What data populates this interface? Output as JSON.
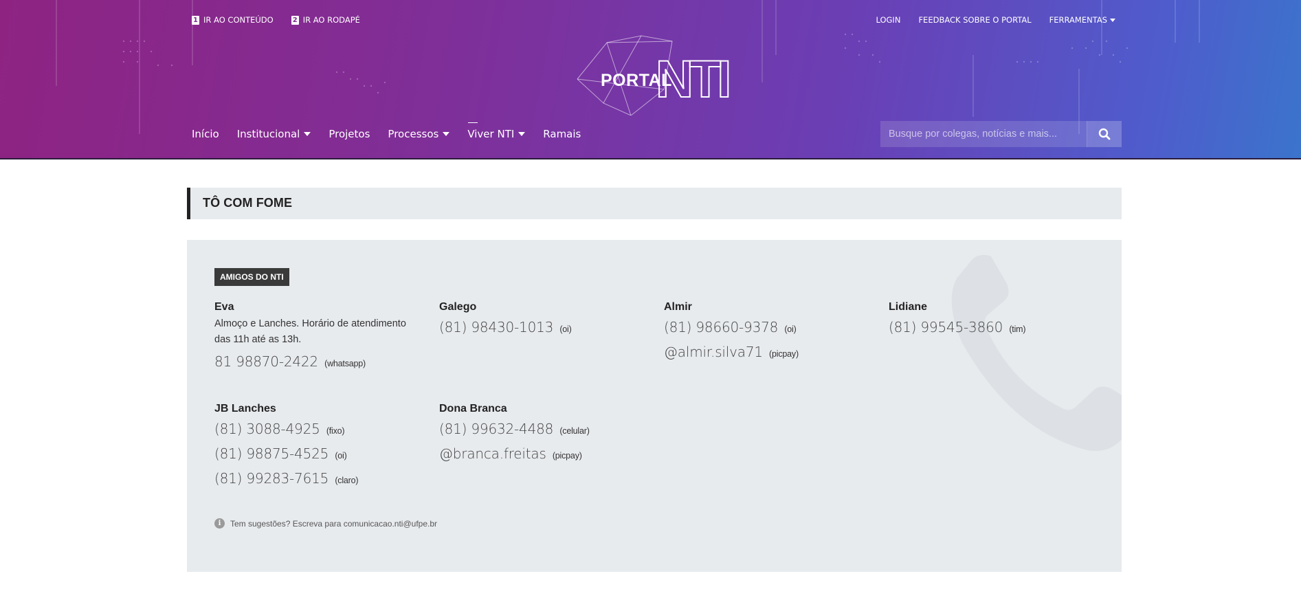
{
  "header": {
    "skip_links": [
      {
        "num": "1",
        "label": "IR AO CONTEÚDO"
      },
      {
        "num": "2",
        "label": "IR AO RODAPÉ"
      }
    ],
    "top_links": [
      {
        "label": "LOGIN"
      },
      {
        "label": "FEEDBACK SOBRE O PORTAL"
      },
      {
        "label": "FERRAMENTAS"
      }
    ],
    "logo": {
      "portal": "PORTAL",
      "nti": "NTI"
    },
    "nav": [
      {
        "label": "Início"
      },
      {
        "label": "Institucional"
      },
      {
        "label": "Projetos"
      },
      {
        "label": "Processos"
      },
      {
        "label": "Viver NTI"
      },
      {
        "label": "Ramais"
      }
    ],
    "search": {
      "placeholder": "Busque por colegas, notícias e mais...",
      "icon": "search-icon"
    }
  },
  "page": {
    "title": "TÔ COM FOME",
    "badge": "AMIGOS DO NTI",
    "contacts": [
      {
        "name": "Eva",
        "desc": "Almoço e Lanches. Horário de atendimento das 11h até as 13h.",
        "lines": [
          {
            "value": "81 98870-2422",
            "tag": "(whatsapp)"
          }
        ]
      },
      {
        "name": "Galego",
        "lines": [
          {
            "value": "(81) 98430-1013",
            "tag": "(oi)"
          }
        ]
      },
      {
        "name": "Almir",
        "lines": [
          {
            "value": "(81) 98660-9378",
            "tag": "(oi)"
          },
          {
            "value": "@almir.silva71",
            "tag": "(picpay)"
          }
        ]
      },
      {
        "name": "Lidiane",
        "lines": [
          {
            "value": "(81) 99545-3860",
            "tag": "(tim)"
          }
        ]
      },
      {
        "name": "JB Lanches",
        "lines": [
          {
            "value": "(81) 3088-4925",
            "tag": "(fixo)"
          },
          {
            "value": "(81) 98875-4525",
            "tag": "(oi)"
          },
          {
            "value": "(81) 99283-7615",
            "tag": "(claro)"
          }
        ]
      },
      {
        "name": "Dona Branca",
        "lines": [
          {
            "value": "(81) 99632-4488",
            "tag": "(celular)"
          },
          {
            "value": "@branca.freitas",
            "tag": "(picpay)"
          }
        ]
      }
    ],
    "footnote": "Tem sugestões? Escreva para comunicacao.nti@ufpe.br"
  },
  "colors": {
    "header_start": "#8e2382",
    "header_end": "#3b74cc",
    "panel_bg": "#e8ebee",
    "badge_bg": "#3a3a3a"
  }
}
